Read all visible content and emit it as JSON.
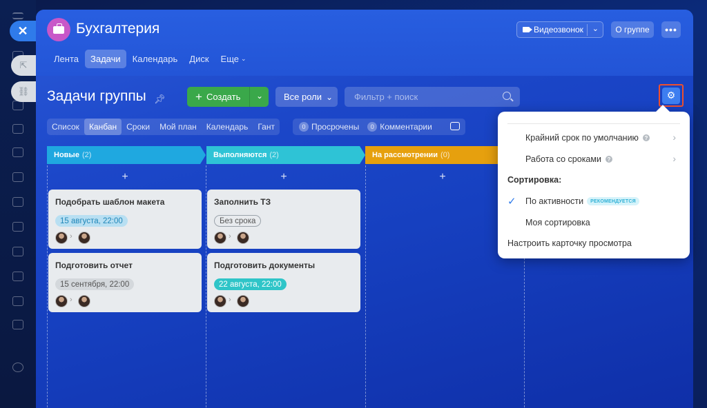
{
  "group": {
    "title": "Бухгалтерия",
    "video_label": "Видеозвонок",
    "about_label": "О группе",
    "more_label": "•••",
    "nav": [
      {
        "label": "Лента"
      },
      {
        "label": "Задачи"
      },
      {
        "label": "Календарь"
      },
      {
        "label": "Диск"
      },
      {
        "label": "Еще"
      }
    ]
  },
  "toolbar": {
    "page_title": "Задачи группы",
    "create_label": "Создать",
    "roles_label": "Все роли",
    "search_placeholder": "Фильтр + поиск"
  },
  "views": [
    "Список",
    "Канбан",
    "Сроки",
    "Мой план",
    "Календарь",
    "Гант"
  ],
  "counters": [
    {
      "count": "0",
      "label": "Просрочены"
    },
    {
      "count": "0",
      "label": "Комментарии"
    }
  ],
  "columns": [
    {
      "name": "Новые",
      "count": "(2)",
      "color": "#1fa8e0"
    },
    {
      "name": "Выполняются",
      "count": "(2)",
      "color": "#2ec3d6"
    },
    {
      "name": "На рассмотрении",
      "count": "(0)",
      "color": "#e6a00e"
    }
  ],
  "cards": [
    {
      "title": "Подобрать шаблон макета",
      "deadline": "15 августа, 22:00",
      "style": "blue"
    },
    {
      "title": "Подготовить отчет",
      "deadline": "15 сентября, 22:00",
      "style": "gray"
    },
    {
      "title": "Заполнить ТЗ",
      "deadline": "Без срока",
      "style": "grayo"
    },
    {
      "title": "Подготовить документы",
      "deadline": "22 августа, 22:00",
      "style": "teal"
    }
  ],
  "add_symbol": "+",
  "popup": {
    "item_default_deadline": "Крайний срок по умолчанию",
    "item_work_deadlines": "Работа со сроками",
    "sort_heading": "Сортировка:",
    "sort_activity": "По активности",
    "recommended_badge": "РЕКОМЕНДУЕТСЯ",
    "sort_mine": "Моя сортировка",
    "configure_card": "Настроить карточку просмотра"
  }
}
